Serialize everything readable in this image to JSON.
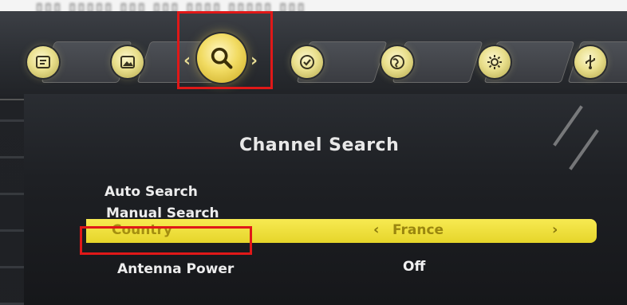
{
  "menu": {
    "title": "Channel Search",
    "items": [
      {
        "label": "Auto Search"
      },
      {
        "label": "Manual Search"
      },
      {
        "label": "Country",
        "value": "France",
        "prev_arrow": "‹",
        "next_arrow": "›",
        "selected": true
      },
      {
        "label": "Antenna Power",
        "value": "Off"
      }
    ]
  },
  "tabs": {
    "icons": [
      "info-icon",
      "picture-icon",
      "search-icon",
      "time-check-icon",
      "globe-icon",
      "settings-gear-icon",
      "usb-icon"
    ],
    "active": "search-icon",
    "active_arrows": {
      "left": "‹",
      "right": "›"
    }
  },
  "colors": {
    "highlight_box": "#e01818",
    "selected_bar": "#f0df3e",
    "icon_gold": "#f1db62",
    "background_dark": "#1c1e22"
  }
}
